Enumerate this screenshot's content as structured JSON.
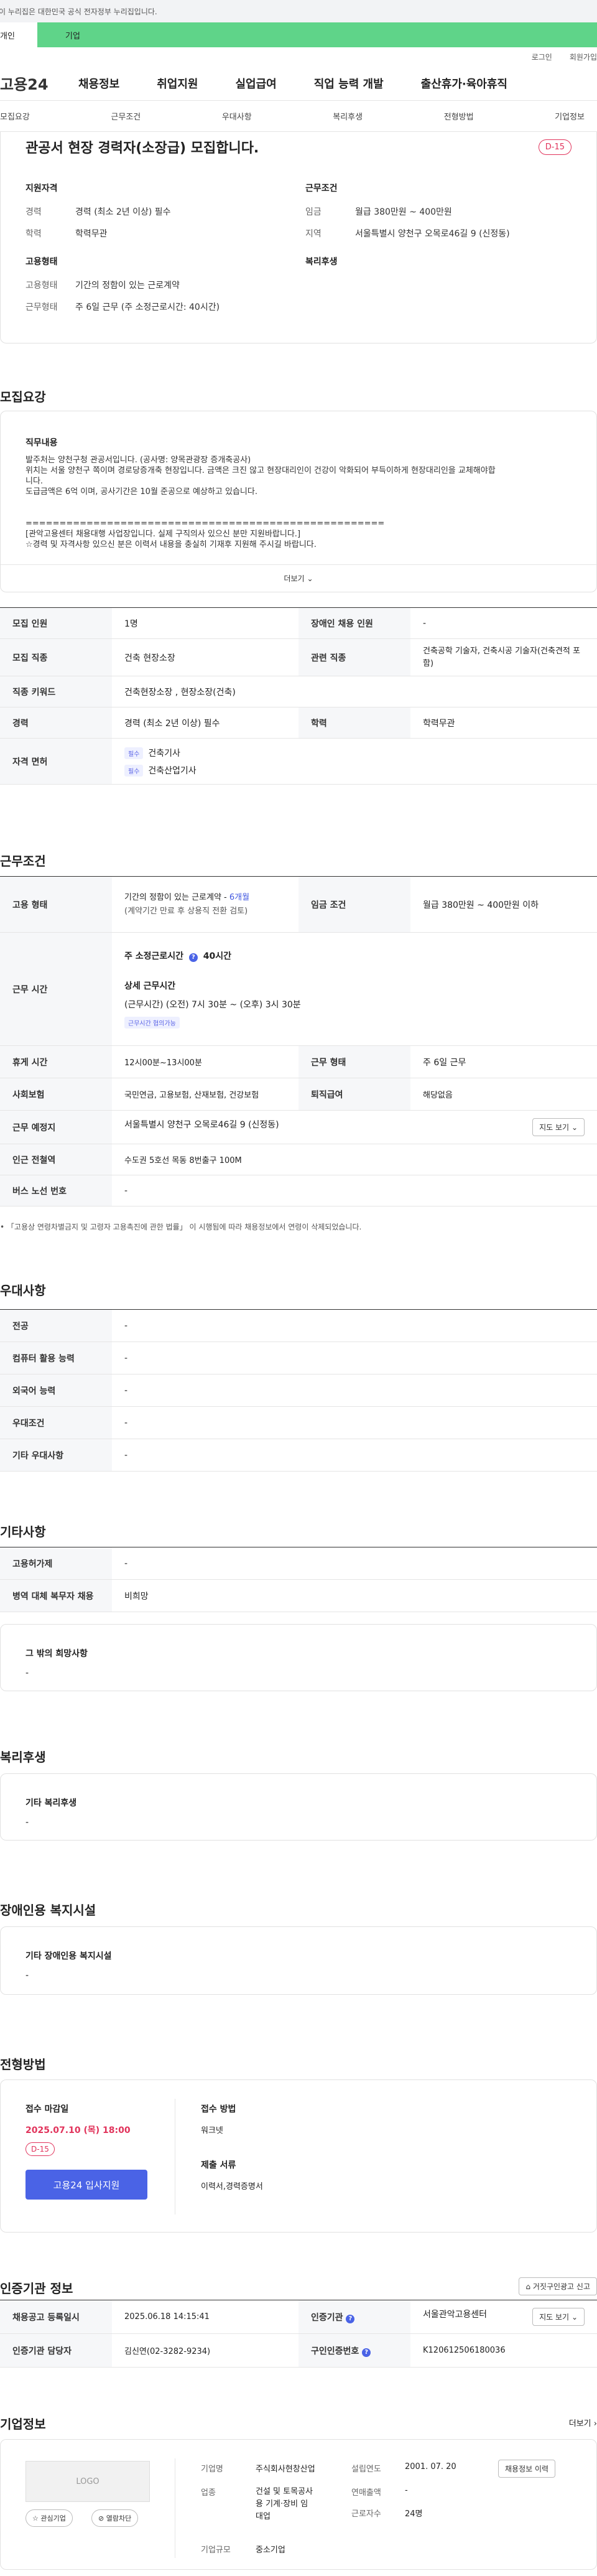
{
  "gov_banner": "이 누리집은 대한민국 공식 전자정부 누리집입니다.",
  "user_tabs": {
    "personal": "개인",
    "company": "기업"
  },
  "topbar": {
    "login": "로그인",
    "signup": "회원가입"
  },
  "logo": "고용24",
  "mainnav": [
    "채용정보",
    "취업지원",
    "실업급여",
    "직업 능력 개발",
    "출산휴가·육아휴직"
  ],
  "subtabs": [
    "모집요강",
    "근무조건",
    "우대사항",
    "복리후생",
    "전형방법",
    "기업정보"
  ],
  "summary": {
    "title": "관공서 현장 경력자(소장급) 모집합니다.",
    "dday": "D-15",
    "qual_head": "지원자격",
    "qual": [
      {
        "k": "경력",
        "v": "경력 (최소 2년 이상) 필수"
      },
      {
        "k": "학력",
        "v": "학력무관"
      }
    ],
    "work_head": "근무조건",
    "work": [
      {
        "k": "임금",
        "v": "월급 380만원 ~ 400만원"
      },
      {
        "k": "지역",
        "v": "서울특별시 양천구 오목로46길 9 (신정동)"
      }
    ],
    "emp_head": "고용형태",
    "emp": [
      {
        "k": "고용형태",
        "v": "기간의 정함이 있는 근로계약"
      },
      {
        "k": "근무형태",
        "v": "주 6일 근무 (주 소정근로시간: 40시간)"
      }
    ],
    "welfare_head": "복리후생"
  },
  "recruit": {
    "title": "모집요강",
    "duty_head": "직무내용",
    "duty_lines": [
      "발주처는 양천구청 관공서입니다. (공사명: 양목관광장 증개축공사)",
      "위치는 서울 양천구 쪽이며 경로당증개축 현장입니다. 금액은 크진 않고 현장대리인이 건강이 악화되어 부득이하게 현장대리인을 교체해야합",
      "니다.",
      "도급금액은 6억 이며, 공사기간은 10월 준공으로 예상하고 있습니다.",
      "",
      "=====================================================",
      "[관악고용센터 채용대행 사업장입니다. 실제 구직의사 있으신 분만 지원바랍니다.]",
      "☆경력 및 자격사항 있으신 분은 이력서 내용을 충실히 기재후 지원해 주시길 바랍니다."
    ],
    "more": "더보기"
  },
  "recruit_table": {
    "recruit_count_label": "모집 인원",
    "recruit_count": "1명",
    "disabled_label": "장애인 채용 인원",
    "disabled": "-",
    "job_label": "모집 직종",
    "job": "건축 현장소장",
    "related_label": "관련 직종",
    "related": "건축공학 기술자, 건축시공 기술자(건축견적 포함)",
    "keyword_label": "직종 키워드",
    "keyword": "건축현장소장 , 현장소장(건축)",
    "career_label": "경력",
    "career": "경력 (최소 2년 이상) 필수",
    "edu_label": "학력",
    "edu": "학력무관",
    "license_label": "자격 면허",
    "licenses": [
      {
        "tag": "필수",
        "name": "건축기사"
      },
      {
        "tag": "필수",
        "name": "건축산업기사"
      }
    ]
  },
  "work": {
    "title": "근무조건",
    "emp_type_label": "고용 형태",
    "emp_type": "기간의 정함이 있는 근로계약 -",
    "emp_type_link": "6개월",
    "emp_type_sub": "(계약기간 만료 후 상용직 전환 검토)",
    "wage_label": "임금 조건",
    "wage": "월급 380만원 ~ 400만원 이하",
    "hours_label": "근무 시간",
    "weekly_hours": "주 소정근로시간",
    "weekly_hours_val": "40시간",
    "detail_head": "상세 근무시간",
    "detail": "(근무시간) (오전) 7시 30분 ~ (오후) 3시 30분",
    "detail_tag": "근무시간 협의가능",
    "break_label": "휴게 시간",
    "break": "12시00분~13시00분",
    "form_label": "근무 형태",
    "form": "주 6일 근무",
    "insure_label": "사회보험",
    "insure": "국민연금, 고용보험, 산재보험, 건강보험",
    "severance_label": "퇴직급여",
    "severance": "해당없음",
    "place_label": "근무 예정지",
    "place": "서울특별시 양천구 오목로46길 9 (신정동)",
    "map_btn": "지도 보기",
    "subway_label": "인근 전철역",
    "subway": "수도권 5호선 목동 8번출구 100M",
    "bus_label": "버스 노선 번호",
    "bus": "-",
    "note": "「고용상 연령차별금지 및 고령자 고용촉진에 관한 법률」 이 시행됨에 따라 채용정보에서 연령이 삭제되었습니다."
  },
  "prefer": {
    "title": "우대사항",
    "rows": [
      {
        "k": "전공",
        "v": "-"
      },
      {
        "k": "컴퓨터 활용 능력",
        "v": "-"
      },
      {
        "k": "외국어 능력",
        "v": "-"
      },
      {
        "k": "우대조건",
        "v": "-"
      },
      {
        "k": "기타 우대사항",
        "v": "-"
      }
    ]
  },
  "etc": {
    "title": "기타사항",
    "rows": [
      {
        "k": "고용허가제",
        "v": "-"
      },
      {
        "k": "병역 대체 복무자 채용",
        "v": "비희망"
      }
    ],
    "wish_head": "그 밖의 희망사항",
    "wish": "-"
  },
  "welfare": {
    "title": "복리후생",
    "head": "기타 복리후생",
    "value": "-"
  },
  "facility": {
    "title": "장애인용 복지시설",
    "head": "기타 장애인용 복지시설",
    "value": "-"
  },
  "screening": {
    "title": "전형방법",
    "deadline_head": "접수 마감일",
    "deadline": "2025.07.10 (목) 18:00",
    "dday": "D-15",
    "apply": "고용24 입사지원",
    "method_head": "접수 방법",
    "method": "워크넷",
    "docs_head": "제출 서류",
    "docs": "이력서,경력증명서"
  },
  "cert": {
    "title": "인증기관 정보",
    "report_btn": "거짓구인광고 신고",
    "reg_label": "채용공고 등록일시",
    "reg": "2025.06.18 14:15:41",
    "org_label": "인증기관",
    "org": "서울관악고용센터",
    "map_btn": "지도 보기",
    "manager_label": "인증기관 담당자",
    "manager": "김신연(02-3282-9234)",
    "reqno_label": "구인인증번호",
    "reqno": "K120612506180036"
  },
  "company": {
    "title": "기업정보",
    "more": "더보기",
    "logo": "LOGO",
    "fav": "관심기업",
    "open": "열람차단",
    "name_label": "기업명",
    "name": "주식회사현창산업",
    "founded_label": "설립연도",
    "founded": "2001. 07. 20",
    "industry_label": "업종",
    "industry_lines": [
      "건설 및 토목공사",
      "용 기계·장비 임",
      "대업"
    ],
    "sales_label": "연매출액",
    "sales": "-",
    "staff_label": "근로자수",
    "staff": "24명",
    "size_label": "기업규모",
    "size": "중소기업",
    "jobs_btn": "채용정보 이력"
  },
  "colors": {
    "accent": "#4a63e6",
    "green": "#5fd489",
    "red": "#e1335b"
  }
}
